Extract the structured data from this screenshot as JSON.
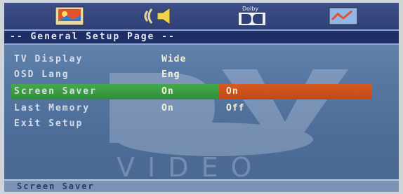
{
  "topbar": {
    "icons": [
      {
        "name": "general-setup-icon"
      },
      {
        "name": "speaker-setup-icon"
      },
      {
        "name": "dolby-digital-icon",
        "label": "Dolby"
      },
      {
        "name": "preferences-icon"
      }
    ]
  },
  "page": {
    "title": "-- General Setup Page --"
  },
  "menu": {
    "items": [
      {
        "label": "TV Display",
        "value": "Wide"
      },
      {
        "label": "OSD Lang",
        "value": "Eng"
      },
      {
        "label": "Screen Saver",
        "value": "On"
      },
      {
        "label": "Last Memory",
        "value": "On"
      },
      {
        "label": "Exit Setup",
        "value": ""
      }
    ]
  },
  "submenu": {
    "options": [
      "On",
      "Off"
    ],
    "selected": "On"
  },
  "background": {
    "logo_text": "VIDEO"
  },
  "status": {
    "text": "Screen Saver"
  },
  "colors": {
    "highlight_row": "#2f8f3a",
    "highlight_option": "#bf4a18",
    "title_bar": "#1f2e66"
  }
}
